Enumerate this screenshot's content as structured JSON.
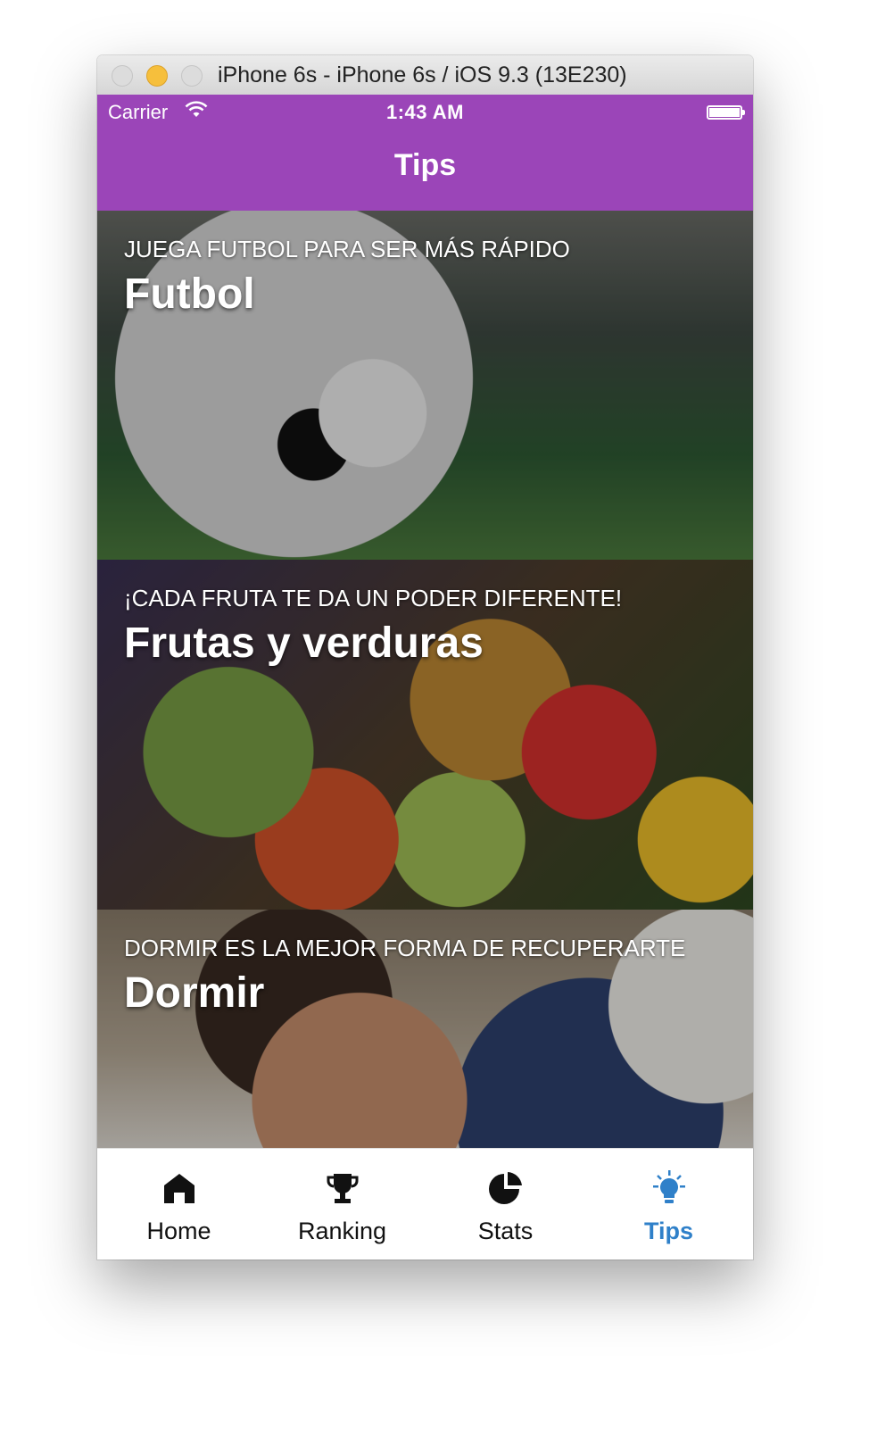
{
  "window": {
    "title": "iPhone 6s - iPhone 6s / iOS 9.3 (13E230)"
  },
  "status_bar": {
    "carrier": "Carrier",
    "time": "1:43 AM"
  },
  "nav": {
    "title": "Tips"
  },
  "tips": [
    {
      "subtitle": "JUEGA FUTBOL PARA SER MÁS RÁPIDO",
      "title": "Futbol"
    },
    {
      "subtitle": "¡CADA FRUTA TE DA UN PODER DIFERENTE!",
      "title": "Frutas y verduras"
    },
    {
      "subtitle": "DORMIR ES LA MEJOR FORMA DE RECUPERARTE",
      "title": "Dormir"
    }
  ],
  "tabbar": {
    "items": [
      {
        "label": "Home",
        "icon": "home-icon"
      },
      {
        "label": "Ranking",
        "icon": "trophy-icon"
      },
      {
        "label": "Stats",
        "icon": "pie-chart-icon"
      },
      {
        "label": "Tips",
        "icon": "lightbulb-icon"
      }
    ],
    "active": "Tips"
  },
  "colors": {
    "header": "#9b45b8",
    "active_tab": "#2f80c9"
  }
}
